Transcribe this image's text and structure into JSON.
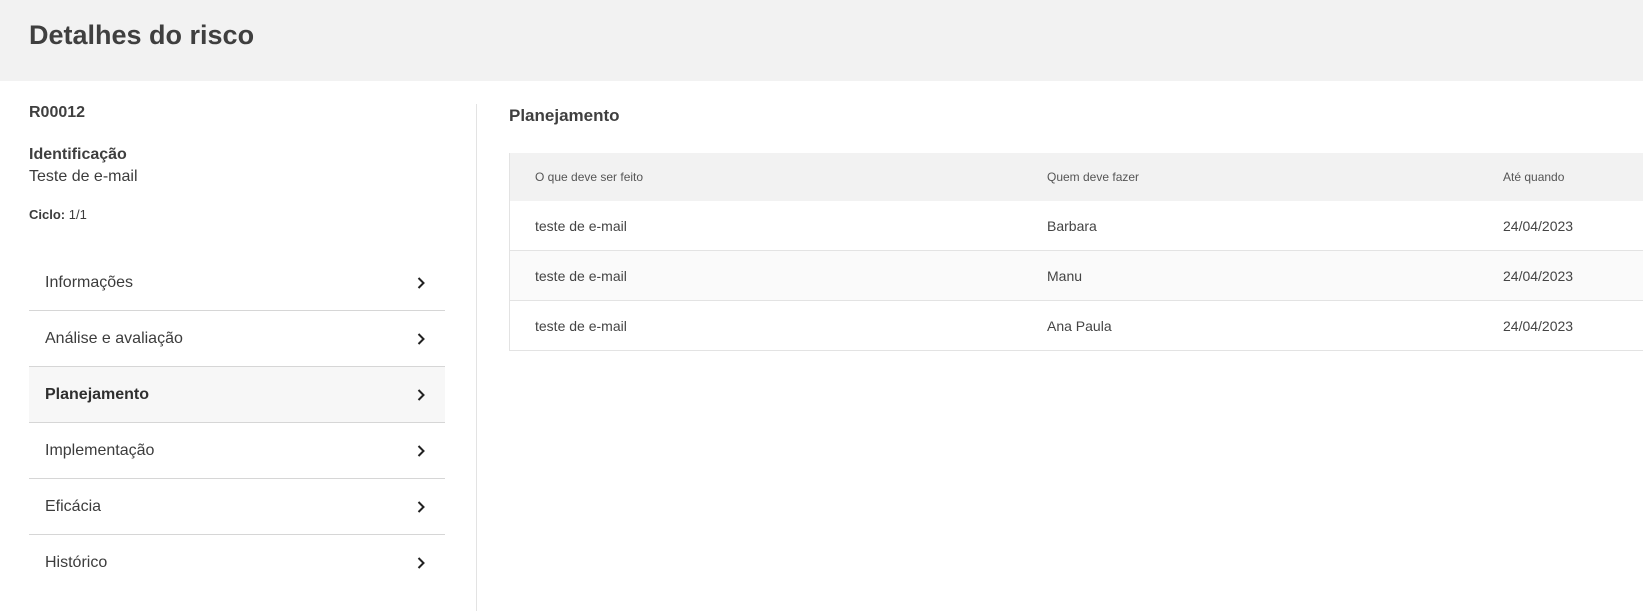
{
  "page": {
    "title": "Detalhes do risco"
  },
  "risk": {
    "code": "R00012",
    "identification_label": "Identificação",
    "identification_value": "Teste de e-mail",
    "cycle_label": "Ciclo:",
    "cycle_value": "1/1"
  },
  "menu": {
    "items": [
      {
        "label": "Informações",
        "icon": "chevron-right-icon",
        "active": false
      },
      {
        "label": "Análise e avaliação",
        "icon": "chevron-right-icon",
        "active": false
      },
      {
        "label": "Planejamento",
        "icon": "chevron-right-icon",
        "active": true
      },
      {
        "label": "Implementação",
        "icon": "chevron-right-icon",
        "active": false
      },
      {
        "label": "Eficácia",
        "icon": "chevron-right-icon",
        "active": false
      },
      {
        "label": "Histórico",
        "icon": "chevron-right-icon",
        "active": false
      }
    ]
  },
  "planning": {
    "title": "Planejamento",
    "columns": [
      "O que deve ser feito",
      "Quem deve fazer",
      "Até quando"
    ],
    "rows": [
      [
        "teste de e-mail",
        "Barbara",
        "24/04/2023"
      ],
      [
        "teste de e-mail",
        "Manu",
        "24/04/2023"
      ],
      [
        "teste de e-mail",
        "Ana Paula",
        "24/04/2023"
      ]
    ]
  },
  "colors": {
    "header_bg": "#f2f2f2",
    "table_header_bg": "#f2f2f2",
    "active_item_bg": "#f7f7f7",
    "text": "#3c3c3c",
    "divider": "#d6d6d6"
  }
}
